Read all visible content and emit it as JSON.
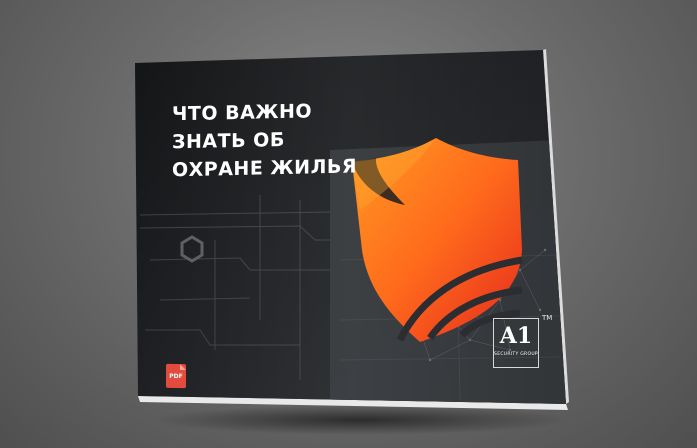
{
  "cover": {
    "title_lines": [
      "ЧТО ВАЖНО",
      "ЗНАТЬ ОБ",
      "ОХРАНЕ ЖИЛЬЯ"
    ],
    "badge": "PDF",
    "logo": {
      "mark": "A1",
      "tagline": "SECURITY GROUP",
      "trademark": "TM"
    }
  },
  "colors": {
    "background": "#6c6c6c",
    "cover": "#1e1f21",
    "shield_top": "#ff8a1e",
    "shield_bottom": "#e8301e",
    "badge": "#e34b3f"
  }
}
